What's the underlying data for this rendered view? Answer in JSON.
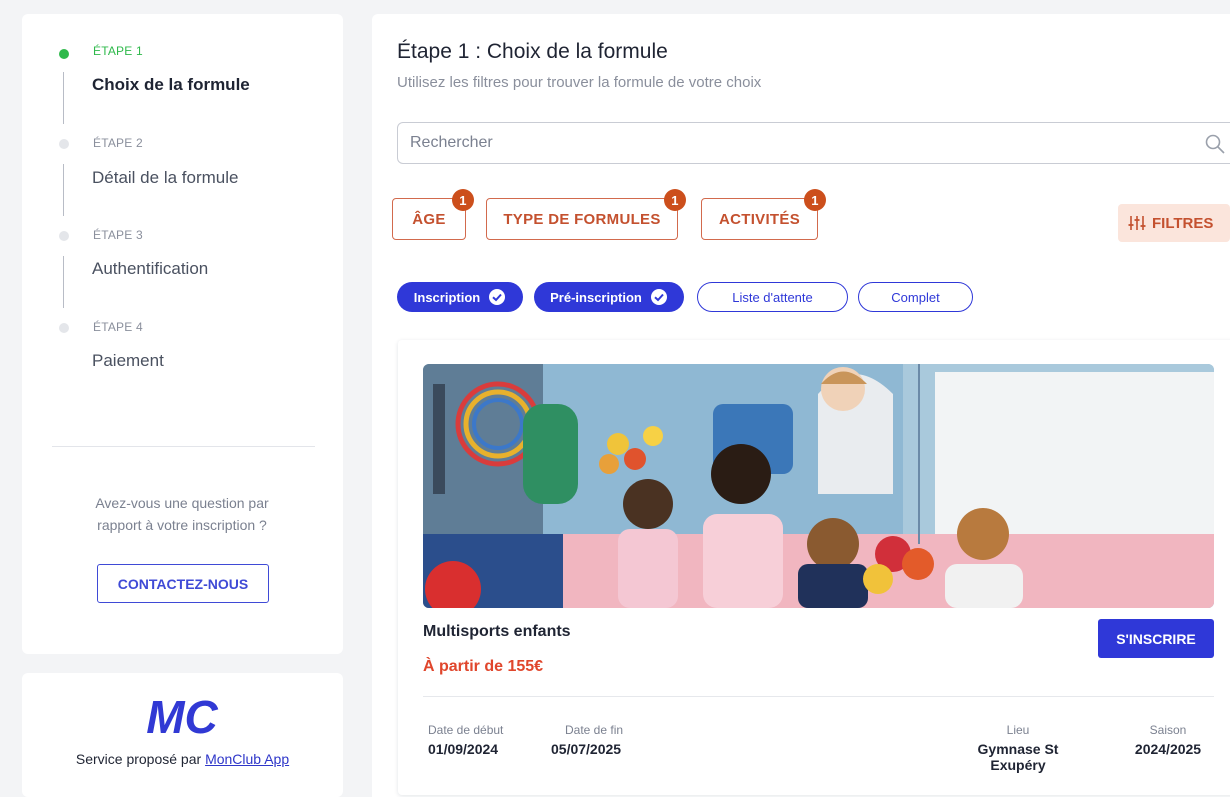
{
  "stepper": {
    "steps": [
      {
        "kicker": "ÉTAPE 1",
        "title": "Choix de la formule"
      },
      {
        "kicker": "ÉTAPE 2",
        "title": "Détail de la formule"
      },
      {
        "kicker": "ÉTAPE 3",
        "title": "Authentification"
      },
      {
        "kicker": "ÉTAPE 4",
        "title": "Paiement"
      }
    ],
    "active_step": 1,
    "question": "Avez-vous une question par rapport à votre inscription ?",
    "contact_label": "CONTACTEZ-NOUS"
  },
  "brand": {
    "logo_text": "MC",
    "service_prefix": "Service proposé par",
    "service_link": "MonClub App"
  },
  "main": {
    "title": "Étape 1 : Choix de la formule",
    "subtitle": "Utilisez les filtres pour trouver la formule de votre choix",
    "search_placeholder": "Rechercher",
    "filters": [
      {
        "label": "ÂGE",
        "badge": "1"
      },
      {
        "label": "TYPE DE FORMULES",
        "badge": "1"
      },
      {
        "label": "ACTIVITÉS",
        "badge": "1"
      }
    ],
    "filtres_label": "FILTRES",
    "chips": [
      {
        "label": "Inscription",
        "selected": true
      },
      {
        "label": "Pré-inscription",
        "selected": true
      },
      {
        "label": "Liste d'attente",
        "selected": false
      },
      {
        "label": "Complet",
        "selected": false
      }
    ]
  },
  "card": {
    "title": "Multisports enfants",
    "price": "À partir de 155€",
    "signup_label": "S'INSCRIRE",
    "start_label": "Date de début",
    "start_value": "01/09/2024",
    "end_label": "Date de fin",
    "end_value": "05/07/2025",
    "place_label": "Lieu",
    "place_value": "Gymnase St Exupéry",
    "season_label": "Saison",
    "season_value": "2024/2025"
  },
  "colors": {
    "accent_blue": "#2f38d8",
    "accent_orange": "#c4512f",
    "step_active_green": "#2fb94b",
    "price_red": "#e0462c"
  }
}
